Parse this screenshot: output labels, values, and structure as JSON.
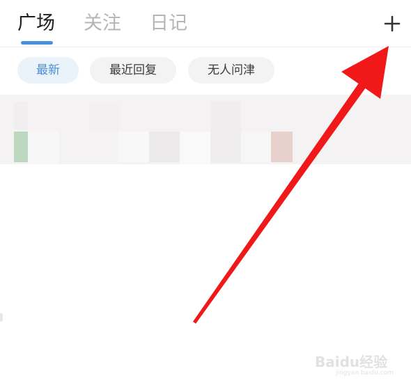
{
  "tabs": [
    {
      "label": "广场",
      "active": true
    },
    {
      "label": "关注",
      "active": false
    },
    {
      "label": "日记",
      "active": false
    }
  ],
  "add_icon": "plus-icon",
  "filters": [
    {
      "label": "最新",
      "active": true
    },
    {
      "label": "最近回复",
      "active": false
    },
    {
      "label": "无人问津",
      "active": false
    }
  ],
  "colors": {
    "accent": "#4a90e2",
    "arrow": "#f01818",
    "active_tab_text": "#1e1e1e",
    "inactive_tab_text": "#b5b5b5"
  },
  "watermark": {
    "main": "Baidu经验",
    "sub": "jingyan.baidu.com"
  }
}
